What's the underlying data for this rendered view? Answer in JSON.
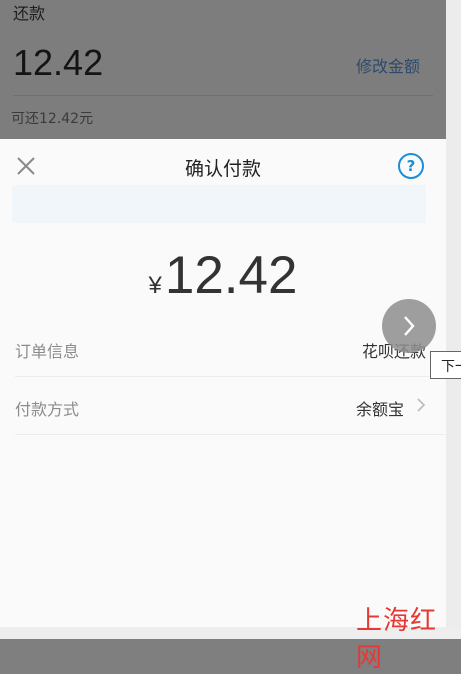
{
  "background_page": {
    "label": "还款",
    "amount": "12.42",
    "edit_link": "修改金额",
    "hint": "可还12.42元"
  },
  "sheet": {
    "title": "确认付款",
    "close_icon": "close-icon",
    "help_icon": "question-icon",
    "help_glyph": "?",
    "currency": "¥",
    "amount": "12.42",
    "rows": [
      {
        "label": "订单信息",
        "value": "花呗还款"
      },
      {
        "label": "付款方式",
        "value": "余额宝"
      }
    ]
  },
  "overlay": {
    "next_icon": "chevron-right-icon",
    "tooltip": "下一"
  },
  "watermark": "上海红网",
  "colors": {
    "accent": "#1a8fd8",
    "watermark": "#e53935",
    "link": "#2c4a6e"
  }
}
